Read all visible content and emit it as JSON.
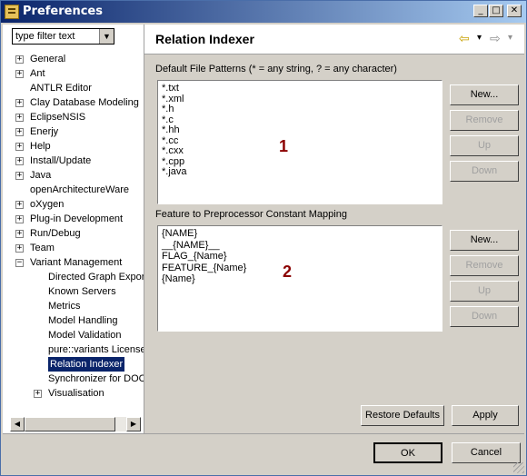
{
  "window": {
    "title": "Preferences",
    "min": "_",
    "max": "□",
    "close": "✕"
  },
  "filter": {
    "text": "type filter text",
    "dropdown": "▼"
  },
  "tree": [
    {
      "label": "General",
      "expander": "+",
      "level": 0
    },
    {
      "label": "Ant",
      "expander": "+",
      "level": 0
    },
    {
      "label": "ANTLR Editor",
      "expander": "",
      "level": 0
    },
    {
      "label": "Clay Database Modeling",
      "expander": "+",
      "level": 0
    },
    {
      "label": "EclipseNSIS",
      "expander": "+",
      "level": 0
    },
    {
      "label": "Enerjy",
      "expander": "+",
      "level": 0
    },
    {
      "label": "Help",
      "expander": "+",
      "level": 0
    },
    {
      "label": "Install/Update",
      "expander": "+",
      "level": 0
    },
    {
      "label": "Java",
      "expander": "+",
      "level": 0
    },
    {
      "label": "openArchitectureWare",
      "expander": "",
      "level": 0
    },
    {
      "label": "oXygen",
      "expander": "+",
      "level": 0
    },
    {
      "label": "Plug-in Development",
      "expander": "+",
      "level": 0
    },
    {
      "label": "Run/Debug",
      "expander": "+",
      "level": 0
    },
    {
      "label": "Team",
      "expander": "+",
      "level": 0
    },
    {
      "label": "Variant Management",
      "expander": "−",
      "level": 0
    },
    {
      "label": "Directed Graph Expor",
      "expander": "",
      "level": 1
    },
    {
      "label": "Known Servers",
      "expander": "",
      "level": 1
    },
    {
      "label": "Metrics",
      "expander": "",
      "level": 1
    },
    {
      "label": "Model Handling",
      "expander": "",
      "level": 1
    },
    {
      "label": "Model Validation",
      "expander": "",
      "level": 1
    },
    {
      "label": "pure::variants License",
      "expander": "",
      "level": 1
    },
    {
      "label": "Relation Indexer",
      "expander": "",
      "level": 1,
      "selected": true
    },
    {
      "label": "Synchronizer for DOC",
      "expander": "",
      "level": 1
    },
    {
      "label": "Visualisation",
      "expander": "+",
      "level": 1
    }
  ],
  "scroll": {
    "left": "◀",
    "right": "▶"
  },
  "page": {
    "title": "Relation Indexer",
    "nav": {
      "back": "⇦",
      "back_dd": "▾",
      "forward": "⇨",
      "forward_dd": "▾"
    }
  },
  "patterns": {
    "label": "Default File Patterns (* = any string, ? = any character)",
    "items": [
      "*.txt",
      "*.xml",
      "*.h",
      "*.c",
      "*.hh",
      "*.cc",
      "*.cxx",
      "*.cpp",
      "*.java"
    ],
    "annotation": "1",
    "buttons": {
      "new": "New...",
      "remove": "Remove",
      "up": "Up",
      "down": "Down"
    }
  },
  "mapping": {
    "label": "Feature to Preprocessor Constant Mapping",
    "items": [
      "{NAME}",
      "__{NAME}__",
      "FLAG_{Name}",
      "FEATURE_{Name}",
      "{Name}"
    ],
    "annotation": "2",
    "buttons": {
      "new": "New...",
      "remove": "Remove",
      "up": "Up",
      "down": "Down"
    }
  },
  "actions": {
    "restore": "Restore Defaults",
    "apply": "Apply",
    "ok": "OK",
    "cancel": "Cancel"
  }
}
